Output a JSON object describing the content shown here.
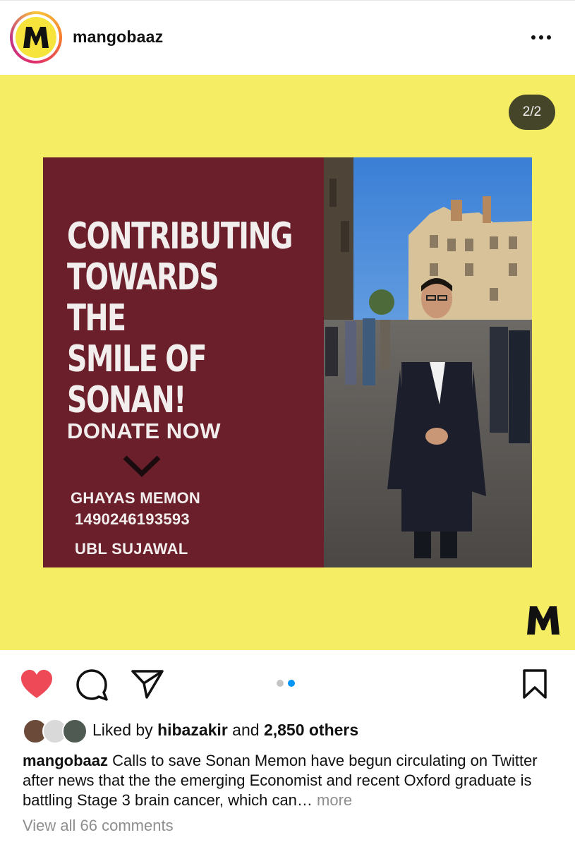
{
  "header": {
    "username": "mangobaaz",
    "avatar_letter": "M"
  },
  "post": {
    "counter": "2/2",
    "background_color": "#f5ed63",
    "card_color": "#6b1f2a",
    "headline": "CONTRIBUTING\nTOWARDS THE\nSMILE OF\nSONAN!",
    "donate_label": "DONATE NOW",
    "account_name": "GHAYAS MEMON",
    "account_number": "1490246193593",
    "bank": "UBL SUJAWAL",
    "watermark": "M"
  },
  "carousel": {
    "total": 2,
    "active_index": 2
  },
  "likes": {
    "prefix": "Liked by ",
    "user": "hibazakir",
    "middle": " and ",
    "others": "2,850 others",
    "liked": true
  },
  "caption": {
    "username": "mangobaaz",
    "text": " Calls to save Sonan Memon have begun circulating on Twitter after news that the the emerging Economist and recent Oxford graduate is battling Stage 3 brain cancer, which can…",
    "more": " more"
  },
  "comments": {
    "label": "View all 66 comments"
  },
  "icons": [
    "more-horizontal-icon",
    "heart-icon",
    "comment-icon",
    "share-icon",
    "bookmark-icon",
    "chevron-down-icon"
  ]
}
